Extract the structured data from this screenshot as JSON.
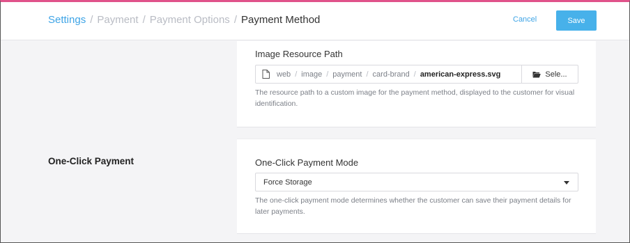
{
  "header": {
    "breadcrumb": [
      {
        "label": "Settings",
        "style": "link"
      },
      {
        "label": "Payment",
        "style": "muted"
      },
      {
        "label": "Payment Options",
        "style": "muted"
      },
      {
        "label": "Payment Method",
        "style": "current"
      }
    ],
    "separator": "/",
    "cancel_label": "Cancel",
    "save_label": "Save"
  },
  "image_resource": {
    "label": "Image Resource Path",
    "path_segments": [
      "web",
      "image",
      "payment",
      "card-brand"
    ],
    "file_name": "american-express.svg",
    "select_label": "Sele...",
    "help": "The resource path to a custom image for the payment method, displayed to the customer for visual identification."
  },
  "one_click": {
    "section_title": "One-Click Payment",
    "label": "One-Click Payment Mode",
    "selected_value": "Force Storage",
    "help": "The one-click payment mode determines whether the customer can save their payment details for later payments."
  },
  "colors": {
    "accent": "#3ea4e6",
    "save_button": "#47b1ea",
    "top_border": "#e0528a"
  },
  "icons": [
    "file-icon",
    "folder-open-icon",
    "caret-down-icon"
  ]
}
